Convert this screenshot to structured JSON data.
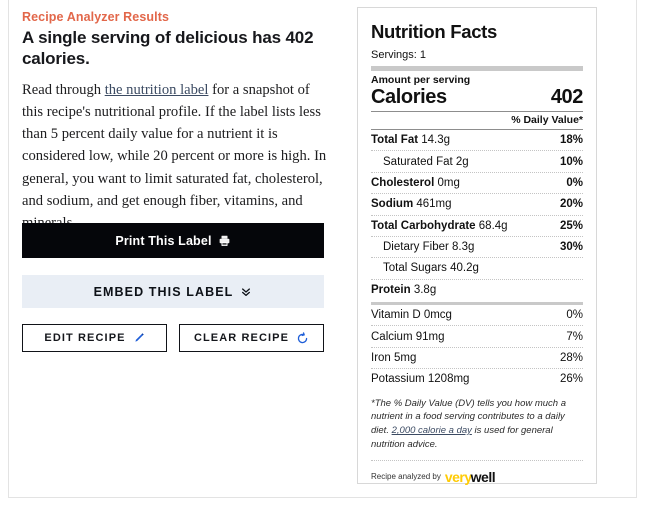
{
  "left": {
    "kicker": "Recipe Analyzer Results",
    "headline": "A single serving of delicious has 402 calories.",
    "paragraph_part1": "Read through ",
    "paragraph_link": "the nutrition label",
    "paragraph_part2": " for a snapshot of this recipe's nutritional profile. If the label lists less than 5 percent daily value for a nutrient it is considered low, while 20 percent or more is high. In general, you want to limit saturated fat, cholesterol, and sodium, and get enough fiber, vitamins, and minerals.",
    "buttons": {
      "print": "Print This Label",
      "print_icon": "printer-icon",
      "embed": "EMBED THIS LABEL",
      "embed_icon": "chevron-double-down-icon",
      "edit": "EDIT RECIPE",
      "edit_icon": "pencil-icon",
      "clear": "CLEAR RECIPE",
      "clear_icon": "refresh-circle-icon"
    }
  },
  "nutrition": {
    "title": "Nutrition Facts",
    "servings_label": "Servings:",
    "servings_value": "1",
    "amount_per_serving": "Amount per serving",
    "calories_label": "Calories",
    "calories_value": "402",
    "daily_value_header": "% Daily Value*",
    "rows": [
      {
        "name": "Total Fat",
        "amount": "14.3g",
        "pct": "18%",
        "indent": false,
        "bold": true
      },
      {
        "name": "Saturated Fat",
        "amount": "2g",
        "pct": "10%",
        "indent": true,
        "bold": false
      },
      {
        "name": "Cholesterol",
        "amount": "0mg",
        "pct": "0%",
        "indent": false,
        "bold": true
      },
      {
        "name": "Sodium",
        "amount": "461mg",
        "pct": "20%",
        "indent": false,
        "bold": true
      },
      {
        "name": "Total Carbohydrate",
        "amount": "68.4g",
        "pct": "25%",
        "indent": false,
        "bold": true
      },
      {
        "name": "Dietary Fiber",
        "amount": "8.3g",
        "pct": "30%",
        "indent": true,
        "bold": false
      },
      {
        "name": "Total Sugars",
        "amount": "40.2g",
        "pct": "",
        "indent": true,
        "bold": false
      },
      {
        "name": "Protein",
        "amount": "3.8g",
        "pct": "",
        "indent": false,
        "bold": true
      }
    ],
    "vitamins": [
      {
        "name": "Vitamin D",
        "amount": "0mcg",
        "pct": "0%"
      },
      {
        "name": "Calcium",
        "amount": "91mg",
        "pct": "7%"
      },
      {
        "name": "Iron",
        "amount": "5mg",
        "pct": "28%"
      },
      {
        "name": "Potassium",
        "amount": "1208mg",
        "pct": "26%"
      }
    ],
    "footnote_part1": "*The % Daily Value (DV) tells you how much a nutrient in a food serving contributes to a daily diet. ",
    "footnote_link": "2,000 calorie a day",
    "footnote_part2": " is used for general nutrition advice.",
    "credit_text": "Recipe analyzed by",
    "logo_first": "very",
    "logo_second": "well"
  },
  "colors": {
    "kicker": "#e2674a",
    "link": "#3b4a62",
    "print_bg": "#05060a",
    "embed_bg": "#e9eef5",
    "icon_blue": "#1e5ed8",
    "logo_yellow": "#ffcb05"
  }
}
